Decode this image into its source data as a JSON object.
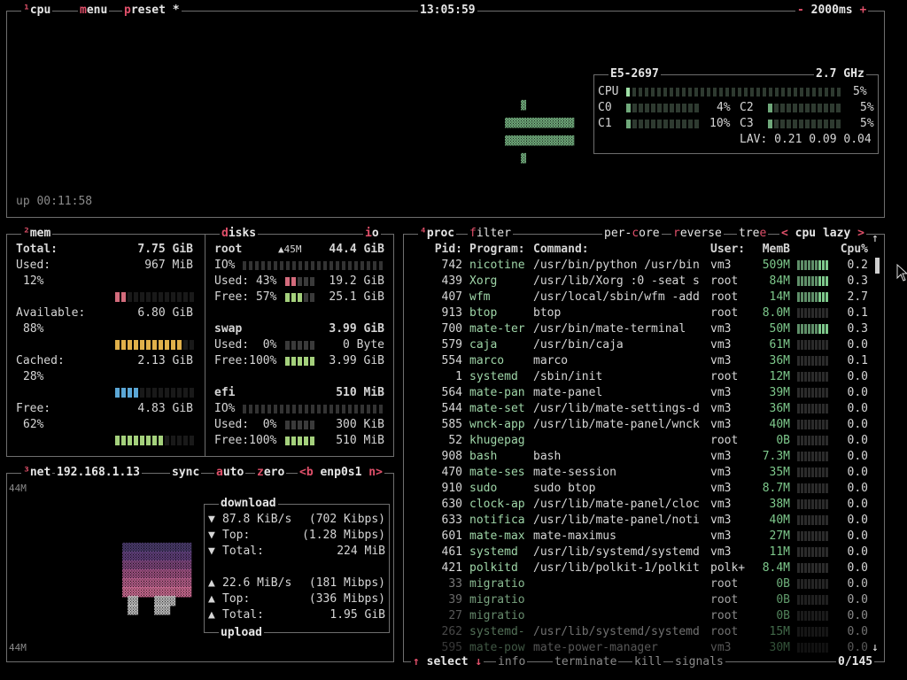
{
  "cpu": {
    "tab_num": "¹",
    "tab_label": "cpu",
    "menu_label": "menu",
    "preset_label": "preset",
    "preset_star": "*",
    "clock": "13:05:59",
    "interval_minus": "-",
    "interval": "2000ms",
    "interval_plus": "+",
    "uptime": "up 00:11:58",
    "model": "E5-2697",
    "freq": "2.7 GHz",
    "total_label": "CPU",
    "total_pct": "5%",
    "cores": [
      {
        "label": "C0",
        "pct": "4%"
      },
      {
        "label": "C2",
        "pct": "5%"
      },
      {
        "label": "C1",
        "pct": "10%"
      },
      {
        "label": "C3",
        "pct": "5%"
      }
    ],
    "lav": "LAV: 0.21 0.09 0.04"
  },
  "mem": {
    "tab_num": "²",
    "tab_label": "mem",
    "total_label": "Total:",
    "total_val": "7.75 GiB",
    "rows": [
      {
        "label": "Used:",
        "val": "967 MiB",
        "pct": "12%",
        "color": "#d36b7c",
        "level": 0.12
      },
      {
        "label": "Available:",
        "val": "6.80 GiB",
        "pct": "88%",
        "color": "#e0b04a",
        "level": 0.88
      },
      {
        "label": "Cached:",
        "val": "2.13 GiB",
        "pct": "28%",
        "color": "#5ba7d6",
        "level": 0.28
      },
      {
        "label": "Free:",
        "val": "4.83 GiB",
        "pct": "62%",
        "color": "#a4d07c",
        "level": 0.62
      }
    ]
  },
  "disks": {
    "tab_label": "disks",
    "io_label": "io",
    "root": {
      "name": "root",
      "io_rate": "▲45M",
      "size": "44.4 GiB",
      "io": "IO%",
      "used_label": "Used: 43%",
      "used_val": "19.2 GiB",
      "free_label": "Free: 57%",
      "free_val": "25.1 GiB"
    },
    "swap": {
      "name": "swap",
      "size": "3.99 GiB",
      "used_label": "Used:  0%",
      "used_val": "0 Byte",
      "free_label": "Free:100%",
      "free_val": "3.99 GiB"
    },
    "efi": {
      "name": "efi",
      "size": "510 MiB",
      "io": "IO%",
      "used_label": "Used:  0%",
      "used_val": "300 KiB",
      "free_label": "Free:100%",
      "free_val": "510 MiB"
    }
  },
  "net": {
    "tab_num": "³",
    "tab_label": "net",
    "ip": "192.168.1.13",
    "sync": "sync",
    "auto": "auto",
    "zero": "zero",
    "iface_prev": "<b",
    "iface": "enp0s1",
    "iface_next": "n>",
    "scale_top": "44M",
    "scale_bottom": "44M",
    "download_title": "download",
    "upload_title": "upload",
    "dl": [
      {
        "arrow": "▼",
        "label": "87.8 KiB/s",
        "val": "(702 Kibps)"
      },
      {
        "arrow": "▼",
        "label": "Top:",
        "val": "(1.28 Mibps)"
      },
      {
        "arrow": "▼",
        "label": "Total:",
        "val": "224 MiB"
      }
    ],
    "ul": [
      {
        "arrow": "▲",
        "label": "22.6 MiB/s",
        "val": "(181 Mibps)"
      },
      {
        "arrow": "▲",
        "label": "Top:",
        "val": "(336 Mibps)"
      },
      {
        "arrow": "▲",
        "label": "Total:",
        "val": "1.95 GiB"
      }
    ]
  },
  "proc": {
    "tab_num": "⁴",
    "tab_label": "proc",
    "filter": "filter",
    "per_core": "per-core",
    "reverse": "reverse",
    "tree": "tree",
    "sort_prev": "<",
    "sort": "cpu lazy",
    "sort_next": ">",
    "headers": {
      "pid": "Pid:",
      "program": "Program:",
      "command": "Command:",
      "user": "User:",
      "mem": "MemB",
      "cpu": "Cpu%"
    },
    "rows": [
      {
        "pid": "742",
        "program": "nicotine",
        "command": "/usr/bin/python /usr/bin",
        "user": "vm3",
        "mem": "509M",
        "cpu": "0.2",
        "active": true
      },
      {
        "pid": "439",
        "program": "Xorg",
        "command": "/usr/lib/Xorg :0 -seat s",
        "user": "root",
        "mem": "84M",
        "cpu": "0.3",
        "active": true
      },
      {
        "pid": "407",
        "program": "wfm",
        "command": "/usr/local/sbin/wfm -add",
        "user": "root",
        "mem": "14M",
        "cpu": "2.7",
        "active": true
      },
      {
        "pid": "913",
        "program": "btop",
        "command": "btop",
        "user": "root",
        "mem": "8.0M",
        "cpu": "0.1",
        "active": true
      },
      {
        "pid": "700",
        "program": "mate-ter",
        "command": "/usr/bin/mate-terminal",
        "user": "vm3",
        "mem": "50M",
        "cpu": "0.3",
        "active": true
      },
      {
        "pid": "579",
        "program": "caja",
        "command": "/usr/bin/caja",
        "user": "vm3",
        "mem": "61M",
        "cpu": "0.0",
        "active": true
      },
      {
        "pid": "554",
        "program": "marco",
        "command": "marco",
        "user": "vm3",
        "mem": "36M",
        "cpu": "0.1",
        "active": true
      },
      {
        "pid": "1",
        "program": "systemd",
        "command": "/sbin/init",
        "user": "root",
        "mem": "12M",
        "cpu": "0.0",
        "active": true
      },
      {
        "pid": "564",
        "program": "mate-pan",
        "command": "mate-panel",
        "user": "vm3",
        "mem": "39M",
        "cpu": "0.0",
        "active": true
      },
      {
        "pid": "544",
        "program": "mate-set",
        "command": "/usr/lib/mate-settings-d",
        "user": "vm3",
        "mem": "36M",
        "cpu": "0.0",
        "active": true
      },
      {
        "pid": "585",
        "program": "wnck-app",
        "command": "/usr/lib/mate-panel/wnck",
        "user": "vm3",
        "mem": "40M",
        "cpu": "0.0",
        "active": true
      },
      {
        "pid": "52",
        "program": "khugepag",
        "command": "",
        "user": "root",
        "mem": "0B",
        "cpu": "0.0",
        "active": true
      },
      {
        "pid": "908",
        "program": "bash",
        "command": "bash",
        "user": "vm3",
        "mem": "7.3M",
        "cpu": "0.0",
        "active": true
      },
      {
        "pid": "470",
        "program": "mate-ses",
        "command": "mate-session",
        "user": "vm3",
        "mem": "35M",
        "cpu": "0.0",
        "active": true
      },
      {
        "pid": "910",
        "program": "sudo",
        "command": "sudo btop",
        "user": "vm3",
        "mem": "8.7M",
        "cpu": "0.0",
        "active": true
      },
      {
        "pid": "630",
        "program": "clock-ap",
        "command": "/usr/lib/mate-panel/cloc",
        "user": "vm3",
        "mem": "38M",
        "cpu": "0.0",
        "active": true
      },
      {
        "pid": "633",
        "program": "notifica",
        "command": "/usr/lib/mate-panel/noti",
        "user": "vm3",
        "mem": "40M",
        "cpu": "0.0",
        "active": true
      },
      {
        "pid": "601",
        "program": "mate-max",
        "command": "mate-maximus",
        "user": "vm3",
        "mem": "27M",
        "cpu": "0.0",
        "active": true
      },
      {
        "pid": "461",
        "program": "systemd",
        "command": "/usr/lib/systemd/systemd",
        "user": "vm3",
        "mem": "11M",
        "cpu": "0.0",
        "active": true
      },
      {
        "pid": "421",
        "program": "polkitd",
        "command": "/usr/lib/polkit-1/polkit",
        "user": "polk+",
        "mem": "8.4M",
        "cpu": "0.0",
        "active": true
      },
      {
        "pid": "33",
        "program": "migratio",
        "command": "",
        "user": "root",
        "mem": "0B",
        "cpu": "0.0",
        "active": false
      },
      {
        "pid": "39",
        "program": "migratio",
        "command": "",
        "user": "root",
        "mem": "0B",
        "cpu": "0.0",
        "active": false
      },
      {
        "pid": "27",
        "program": "migratio",
        "command": "",
        "user": "root",
        "mem": "0B",
        "cpu": "0.0",
        "active": false
      },
      {
        "pid": "262",
        "program": "systemd-",
        "command": "/usr/lib/systemd/systemd",
        "user": "root",
        "mem": "15M",
        "cpu": "0.0",
        "active": false
      },
      {
        "pid": "595",
        "program": "mate-pow",
        "command": "mate-power-manager",
        "user": "vm3",
        "mem": "30M",
        "cpu": "0.0",
        "active": false
      }
    ],
    "footer": {
      "up": "↑",
      "select": "select",
      "down": "↓",
      "info": "info",
      "terminate": "terminate",
      "kill": "kill",
      "signals": "signals",
      "count": "0/145"
    }
  },
  "colors": {
    "border": "#6e6e6e",
    "accent": "#e0506a",
    "green": "#7ec98c"
  }
}
